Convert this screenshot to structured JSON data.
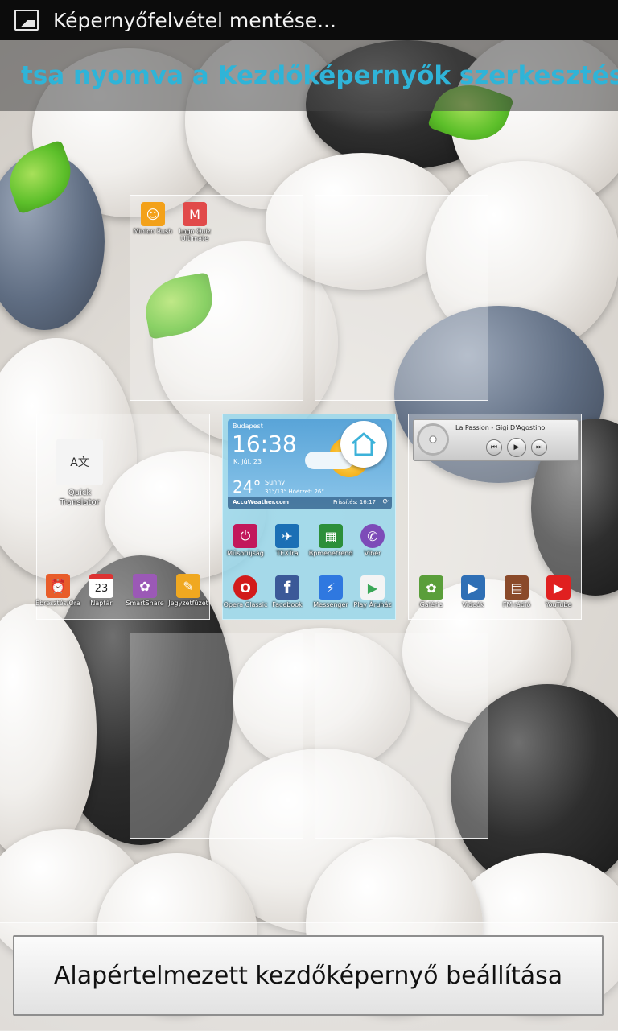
{
  "status_bar": {
    "notification": "Képernyőfelvétel mentése..."
  },
  "hint_text": "tsa nyomva a Kezdőképernyők szerkesztésé",
  "screen1": {
    "apps": [
      {
        "label": "Minion Rush",
        "icon": "minion-rush-icon",
        "color": "#f3a11a"
      },
      {
        "label": "Logo Quiz Ultimate",
        "icon": "logo-quiz-icon",
        "color": "#e14a4a"
      }
    ]
  },
  "screen3": {
    "translator": {
      "label": "Quick Translator",
      "icon": "translator-icon"
    },
    "dock": [
      {
        "label": "Ébresztés/Óra",
        "icon": "alarm-clock-icon",
        "color": "#e85d2a",
        "glyph": "⏰"
      },
      {
        "label": "Naptár",
        "icon": "calendar-icon",
        "color": "#ffffff",
        "glyph": "23"
      },
      {
        "label": "SmartShare",
        "icon": "smartshare-icon",
        "color": "#9b59b6",
        "glyph": "✿"
      },
      {
        "label": "Jegyzetfüzet",
        "icon": "notebook-icon",
        "color": "#f0a820",
        "glyph": "✎"
      }
    ]
  },
  "home_screen": {
    "weather": {
      "city": "Budapest",
      "time": "16:38",
      "date": "K, júl. 23",
      "temp": "24°",
      "condition": "Sunny",
      "hilo": "31°/13°  Hőérzet: 26°",
      "brand": "AccuWeather.com",
      "updated": "Frissítés: 16:17"
    },
    "row1": [
      {
        "label": "Műsorújság",
        "icon": "tv-guide-icon",
        "color": "#c2185b",
        "glyph": "⏻"
      },
      {
        "label": "TEXTra",
        "icon": "textra-icon",
        "color": "#1b6fb5",
        "glyph": "✈"
      },
      {
        "label": "Bpmenetrend",
        "icon": "bus-icon",
        "color": "#2c8f3a",
        "glyph": "▦"
      },
      {
        "label": "Viber",
        "icon": "viber-icon",
        "color": "#7d4bb8",
        "glyph": "✆"
      }
    ],
    "row2": [
      {
        "label": "Opera Classic",
        "icon": "opera-icon",
        "color": "#d21b1b",
        "glyph": "O"
      },
      {
        "label": "Facebook",
        "icon": "facebook-icon",
        "color": "#3b5998",
        "glyph": "f"
      },
      {
        "label": "Messenger",
        "icon": "messenger-icon",
        "color": "#2f78e0",
        "glyph": "⚡"
      },
      {
        "label": "Play Áruház",
        "icon": "play-store-icon",
        "color": "#f4f4f4",
        "glyph": "▶"
      }
    ]
  },
  "screen5": {
    "music": {
      "song": "La Passion - Gigi D'Agostino"
    },
    "dock": [
      {
        "label": "Galéria",
        "icon": "gallery-icon",
        "color": "#5a9e3a",
        "glyph": "✿"
      },
      {
        "label": "Videók",
        "icon": "videos-icon",
        "color": "#2f6fb5",
        "glyph": "▶"
      },
      {
        "label": "FM rádió",
        "icon": "fm-radio-icon",
        "color": "#8a4a2a",
        "glyph": "▤"
      },
      {
        "label": "YouTube",
        "icon": "youtube-icon",
        "color": "#e02020",
        "glyph": "▶"
      }
    ]
  },
  "default_button": "Alapértelmezett kezdőképernyő beállítása"
}
